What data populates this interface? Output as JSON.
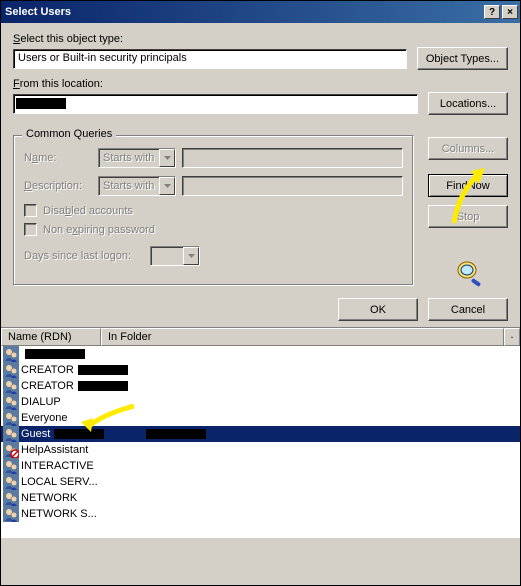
{
  "window": {
    "title": "Select Users",
    "help": "?",
    "close": "×"
  },
  "object_type": {
    "label": "Select this object type:",
    "value": "Users or Built-in security principals",
    "button": "Object Types..."
  },
  "location": {
    "label": "From this location:",
    "value": "",
    "button": "Locations..."
  },
  "queries": {
    "legend": "Common Queries",
    "name_label": "Name:",
    "name_mode": "Starts with",
    "desc_label": "Description:",
    "desc_mode": "Starts with",
    "chk_disabled": "Disabled accounts",
    "chk_nonexp": "Non expiring password",
    "days_label": "Days since last logon:"
  },
  "side": {
    "columns": "Columns...",
    "find": "Find Now",
    "stop": "Stop"
  },
  "actions": {
    "ok": "OK",
    "cancel": "Cancel"
  },
  "list": {
    "col_name": "Name (RDN)",
    "col_folder": "In Folder",
    "rows": [
      {
        "name": "",
        "redacted": true
      },
      {
        "name": "CREATOR",
        "redacted": true
      },
      {
        "name": "CREATOR",
        "redacted": true
      },
      {
        "name": "DIALUP"
      },
      {
        "name": "Everyone"
      },
      {
        "name": "Guest",
        "selected": true,
        "redacted": true
      },
      {
        "name": "HelpAssistant",
        "blocked": true
      },
      {
        "name": "INTERACTIVE"
      },
      {
        "name": "LOCAL SERV..."
      },
      {
        "name": "NETWORK"
      },
      {
        "name": "NETWORK S..."
      }
    ]
  }
}
